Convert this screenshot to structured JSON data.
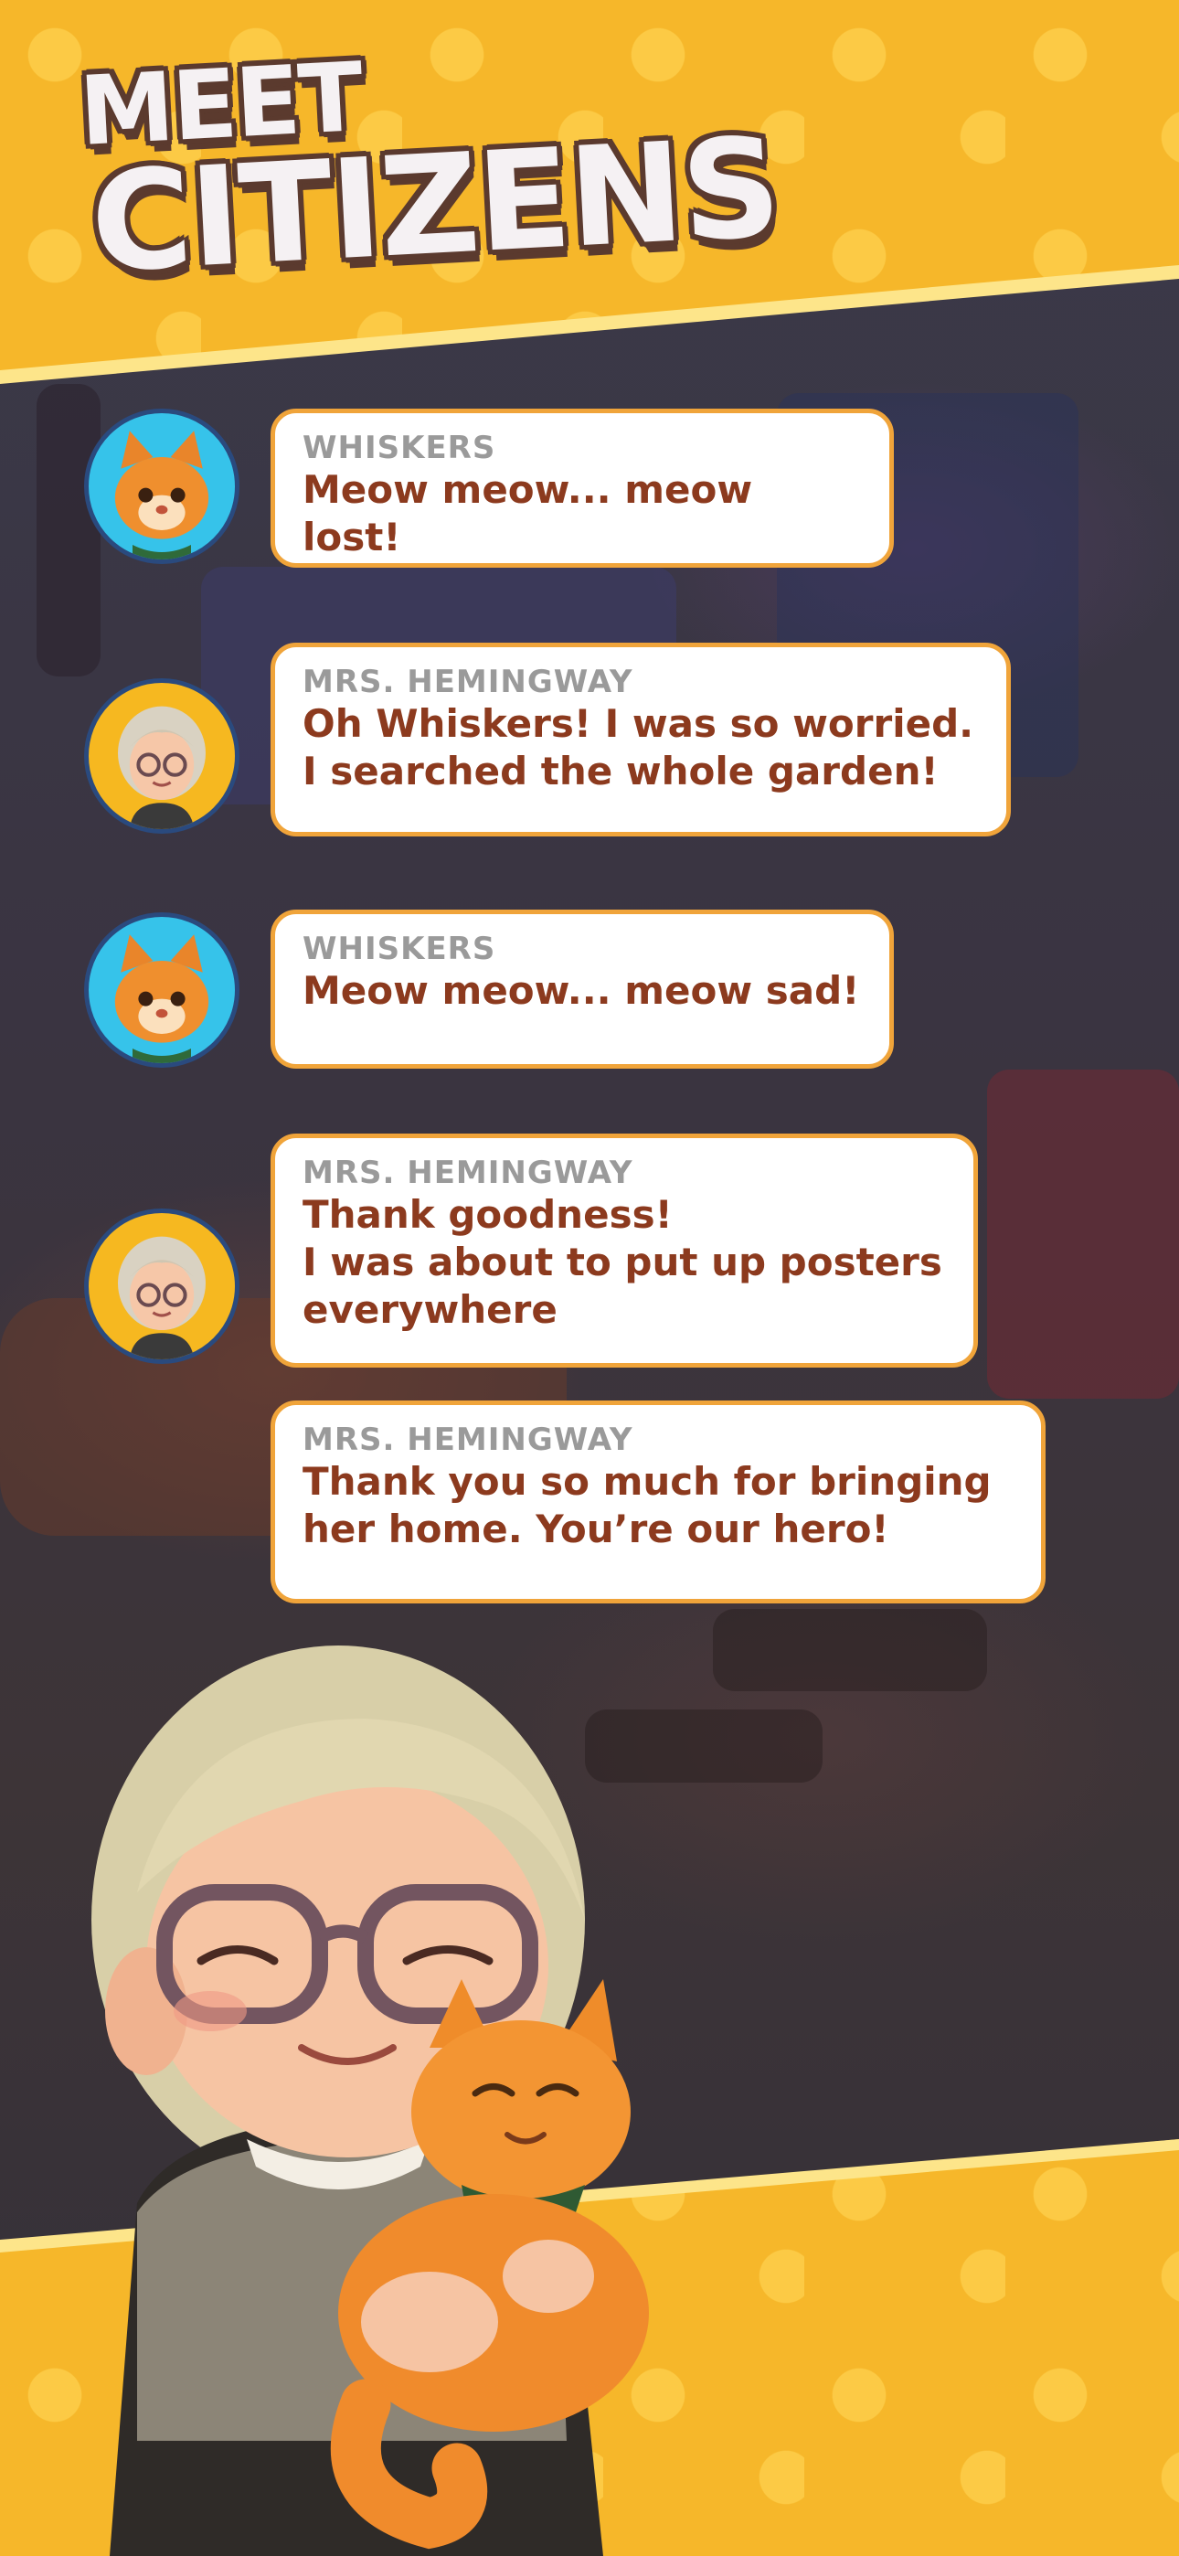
{
  "title": {
    "line1": "MEET",
    "line2": "CITIZENS"
  },
  "colors": {
    "yellow_band": "#f6b72a",
    "bubble_border": "#f0a43a",
    "message_text": "#8c3a1e",
    "name_text": "#9a9a9a",
    "cat_avatar_bg": "#36c3ea",
    "gran_avatar_bg": "#f6b820"
  },
  "dialogue": [
    {
      "speaker": "WHISKERS",
      "avatar": "cat-avatar-icon",
      "message": "Meow meow... meow lost!"
    },
    {
      "speaker": "MRS. HEMINGWAY",
      "avatar": "grandma-avatar-icon",
      "message": "Oh Whiskers! I was so worried.\nI searched the whole garden!"
    },
    {
      "speaker": "WHISKERS",
      "avatar": "cat-avatar-icon",
      "message": "Meow meow... meow sad!"
    },
    {
      "speaker": "MRS. HEMINGWAY",
      "avatar": "grandma-avatar-icon",
      "message": "Thank goodness!\nI was about to put up posters\neverywhere"
    },
    {
      "speaker": "MRS. HEMINGWAY",
      "avatar": null,
      "message": "Thank you so much for bringing\nher home. You’re our hero!"
    }
  ],
  "illustration": {
    "subject": "grandma-hugging-cat-icon"
  }
}
